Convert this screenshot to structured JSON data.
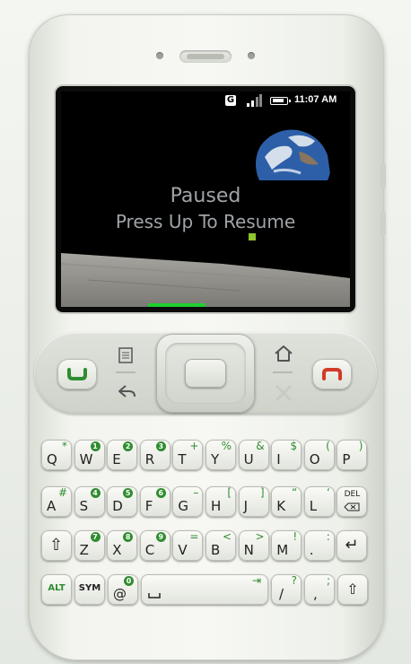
{
  "status_bar": {
    "carrier_icon": "G",
    "signal_icon": "signal-icon",
    "battery_icon": "battery-icon",
    "time": "11:07 AM"
  },
  "game": {
    "paused_label": "Paused",
    "resume_label": "Press Up To Resume",
    "progress": 0.2
  },
  "nav_buttons": {
    "call_icon": "phone-call-icon",
    "menu_icon": "menu-icon",
    "back_icon": "back-arrow-icon",
    "home_icon": "home-icon",
    "search_icon": "x-icon",
    "end_icon": "end-call-icon"
  },
  "colors": {
    "accent_green": "#2f8d2f",
    "progress_green": "#1ecf31",
    "end_call_red": "#d23a2a"
  },
  "keyboard": {
    "row1": [
      {
        "main": "Q",
        "alt": "*"
      },
      {
        "main": "W",
        "num": "1"
      },
      {
        "main": "E",
        "num": "2"
      },
      {
        "main": "R",
        "num": "3"
      },
      {
        "main": "T",
        "alt": "+"
      },
      {
        "main": "Y",
        "alt": "%"
      },
      {
        "main": "U",
        "alt": "&"
      },
      {
        "main": "I",
        "alt": "$"
      },
      {
        "main": "O",
        "alt": "("
      },
      {
        "main": "P",
        "alt": ")"
      }
    ],
    "row2": [
      {
        "main": "A",
        "alt": "#"
      },
      {
        "main": "S",
        "num": "4"
      },
      {
        "main": "D",
        "num": "5"
      },
      {
        "main": "F",
        "num": "6"
      },
      {
        "main": "G",
        "alt": "–"
      },
      {
        "main": "H",
        "alt": "["
      },
      {
        "main": "J",
        "alt": "]"
      },
      {
        "main": "K",
        "alt": "“"
      },
      {
        "main": "L",
        "alt": "‘"
      },
      {
        "main": "DEL",
        "alt": ""
      }
    ],
    "row3": [
      {
        "main": "⇧",
        "alt": ""
      },
      {
        "main": "Z",
        "num": "7"
      },
      {
        "main": "X",
        "num": "8"
      },
      {
        "main": "C",
        "num": "9"
      },
      {
        "main": "V",
        "alt": "="
      },
      {
        "main": "B",
        "alt": "<"
      },
      {
        "main": "N",
        "alt": ">"
      },
      {
        "main": "M",
        "alt": "!"
      },
      {
        "main": ".",
        "alt": ":"
      },
      {
        "main": "↵",
        "alt": ""
      }
    ],
    "row4": {
      "alt": "ALT",
      "sym": "SYM",
      "at": "@",
      "at_num": "0",
      "space_tab": "⇥",
      "slash": "/",
      "slash_alt": "?",
      "comma": ",",
      "comma_alt": ";",
      "shift": "⇧"
    }
  }
}
